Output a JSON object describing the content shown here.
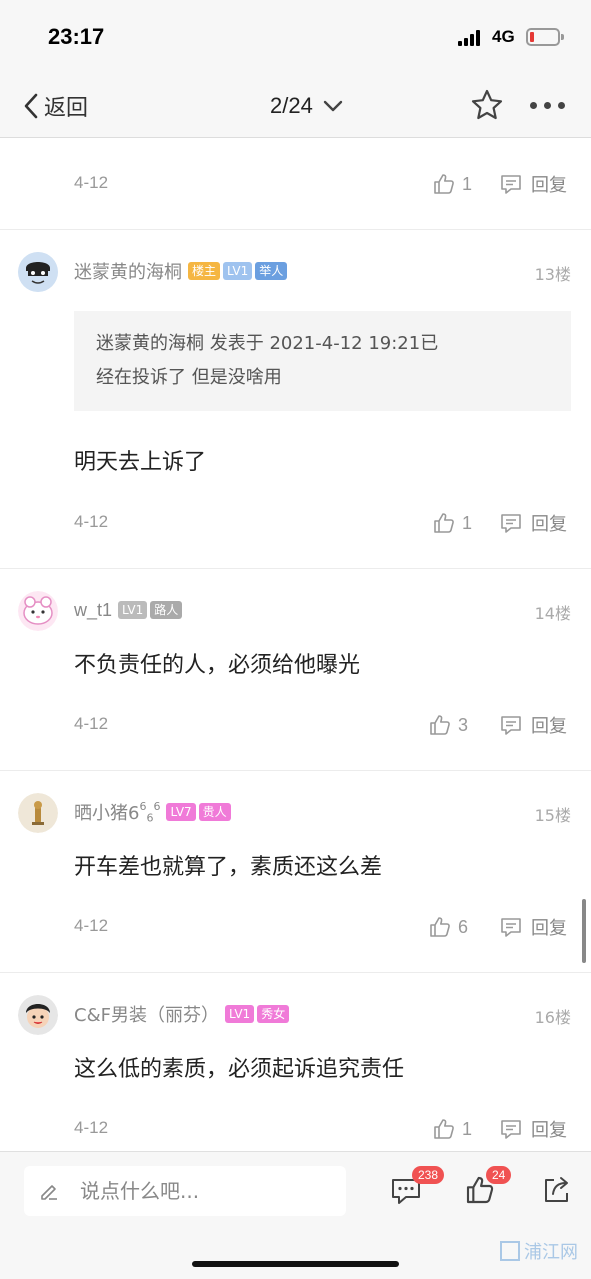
{
  "status": {
    "time": "23:17",
    "network": "4G"
  },
  "nav": {
    "back_label": "返回",
    "page_indicator": "2/24"
  },
  "comments": [
    {
      "date": "4-12",
      "likes": "1",
      "reply_label": "回复"
    },
    {
      "username": "迷蒙黄的海桐",
      "badges": [
        "楼主",
        "LV1",
        "举人"
      ],
      "floor": "13楼",
      "quote_line1": "迷蒙黄的海桐 发表于 2021-4-12 19:21已",
      "quote_line2": "经在投诉了 但是没啥用",
      "content": "明天去上诉了",
      "date": "4-12",
      "likes": "1",
      "reply_label": "回复"
    },
    {
      "username": "w_t1",
      "badges": [
        "LV1",
        "路人"
      ],
      "floor": "14楼",
      "content": "不负责任的人，必须给他曝光",
      "date": "4-12",
      "likes": "3",
      "reply_label": "回复"
    },
    {
      "username": "晒小猪6",
      "username_sup1": "6",
      "username_sub": "6",
      "username_sup2": "6",
      "badges": [
        "LV7",
        "贵人"
      ],
      "floor": "15楼",
      "content": "开车差也就算了，素质还这么差",
      "date": "4-12",
      "likes": "6",
      "reply_label": "回复"
    },
    {
      "username": "C&F男装（丽芬）",
      "badges": [
        "LV1",
        "秀女"
      ],
      "floor": "16楼",
      "content": "这么低的素质，必须起诉追究责任",
      "date": "4-12",
      "likes": "1",
      "reply_label": "回复"
    }
  ],
  "bottom": {
    "input_placeholder": "说点什么吧...",
    "comment_count": "238",
    "like_count": "24",
    "watermark": "浦江网"
  },
  "colors": {
    "badge_owner": "#f5b642",
    "badge_level_blue": "#9fc3ef",
    "badge_title_blue": "#6b9fe0",
    "badge_gray": "#bbbbbb",
    "badge_pink": "#f07ad8",
    "notify_red": "#f05252"
  },
  "icons": [
    "chevron-left-icon",
    "chevron-down-icon",
    "star-icon",
    "more-icon",
    "thumbs-up-icon",
    "comment-bubble-icon",
    "pencil-icon",
    "share-icon"
  ]
}
